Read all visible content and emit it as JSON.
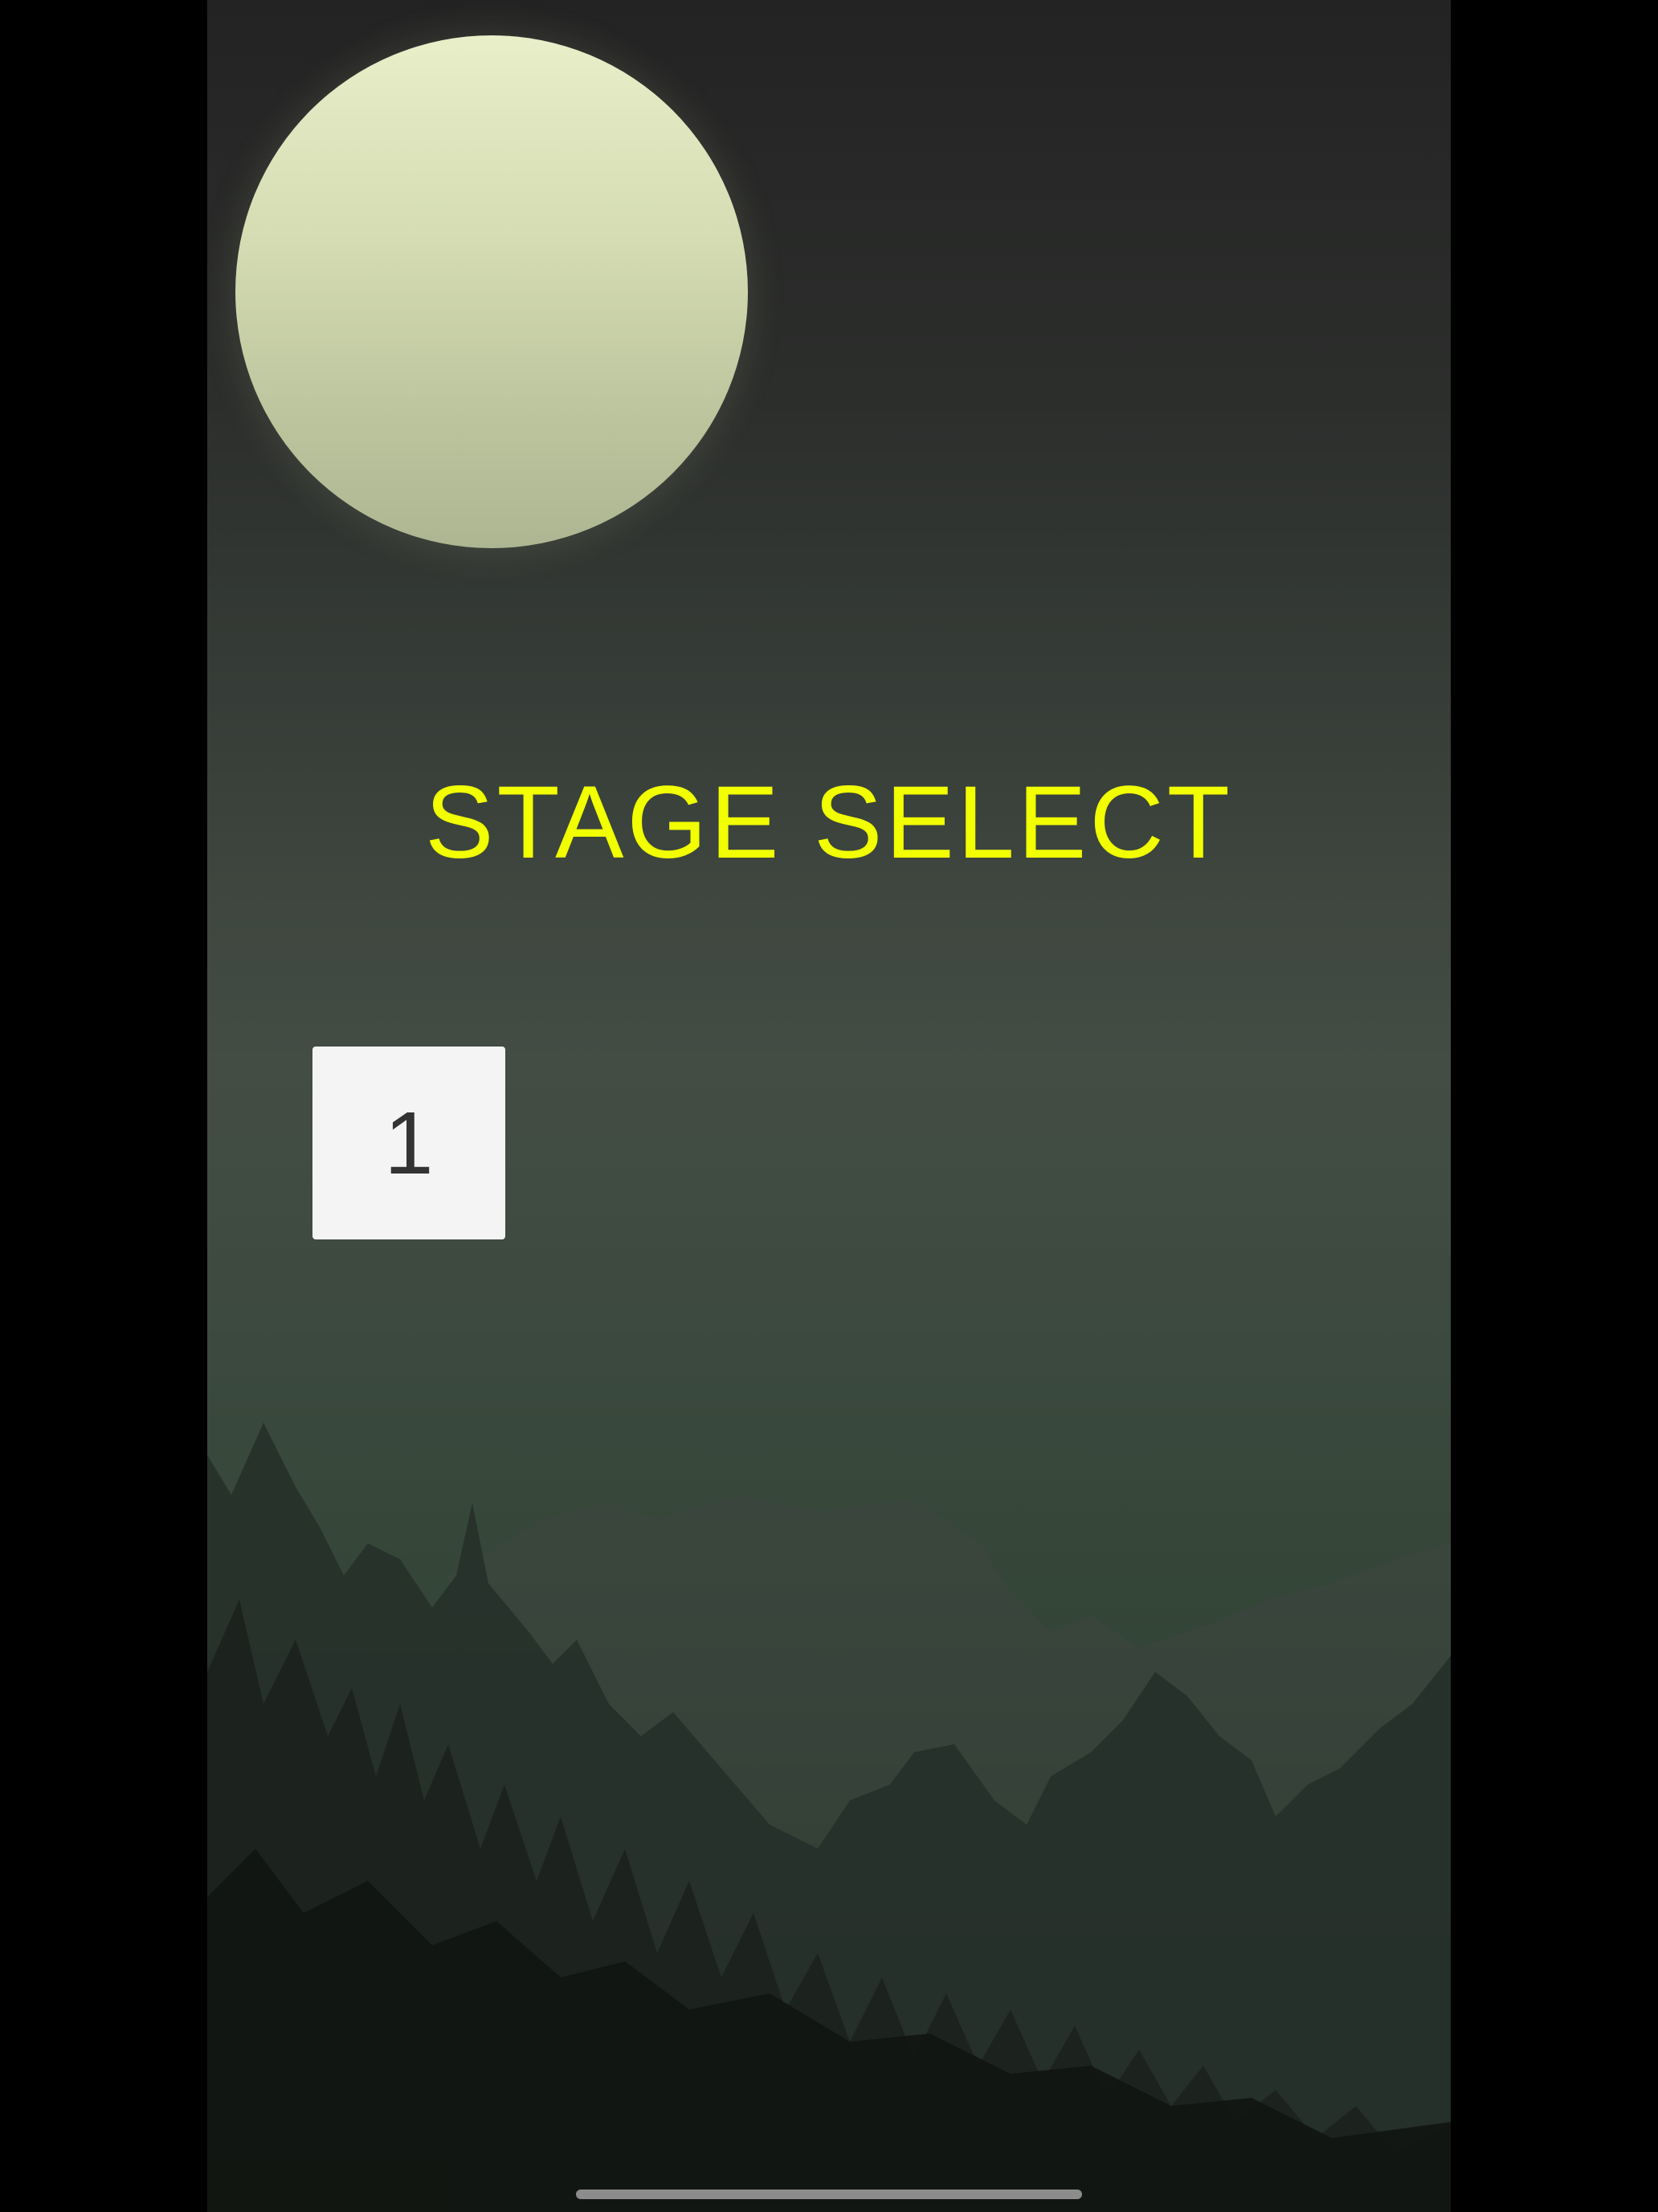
{
  "screen": {
    "title": "STAGE SELECT"
  },
  "stages": [
    {
      "label": "1"
    }
  ],
  "colors": {
    "title": "#f2ff00",
    "button_bg": "#f4f4f4",
    "button_text": "#333333",
    "moon": "#d5dcb3",
    "letterbox": "#000000"
  },
  "icons": {
    "moon": "moon-icon",
    "home_indicator": "home-indicator-bar"
  }
}
